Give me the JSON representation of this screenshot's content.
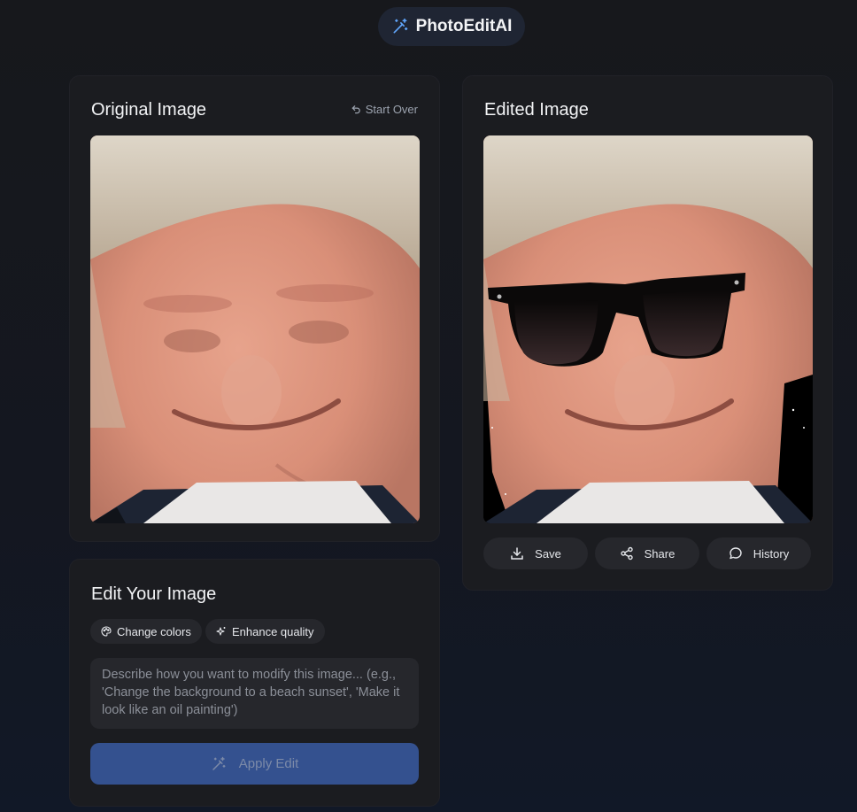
{
  "app": {
    "name": "PhotoEditAI",
    "icon": "magic-wand-icon"
  },
  "original_panel": {
    "title": "Original Image",
    "start_over_label": "Start Over",
    "start_over_icon": "undo-icon"
  },
  "edited_panel": {
    "title": "Edited Image",
    "actions": [
      {
        "label": "Save",
        "icon": "download-icon"
      },
      {
        "label": "Share",
        "icon": "share-icon"
      },
      {
        "label": "History",
        "icon": "chat-bubble-icon"
      }
    ]
  },
  "edit_panel": {
    "title": "Edit Your Image",
    "chips": [
      {
        "label": "Change colors",
        "icon": "palette-icon"
      },
      {
        "label": "Enhance quality",
        "icon": "sparkles-icon"
      }
    ],
    "prompt_placeholder": "Describe how you want to modify this image... (e.g., 'Change the background to a beach sunset', 'Make it look like an oil painting')",
    "apply_label": "Apply Edit",
    "apply_icon": "magic-wand-icon"
  },
  "colors": {
    "background": "#17181c",
    "card": "#1b1c20",
    "accent": "#34518f",
    "brand_pill": "#1f2533"
  }
}
